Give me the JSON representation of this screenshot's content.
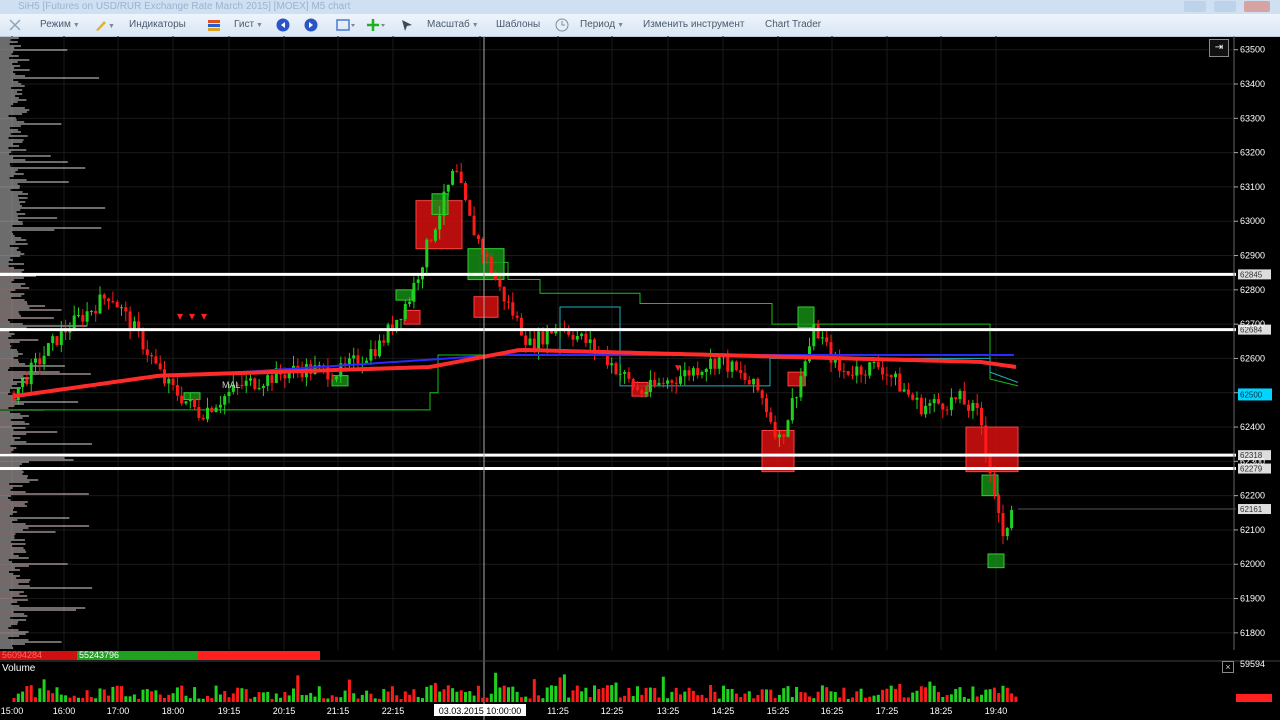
{
  "window": {
    "title": "SiH5 [Futures on USD/RUR Exchange Rate March 2015] [MOEX] M5 chart",
    "controls": [
      "minimize-icon",
      "maximize-icon",
      "close-icon"
    ]
  },
  "toolbar": {
    "items": [
      {
        "name": "mode-menu",
        "label": "Режим",
        "dropdown": true
      },
      {
        "name": "indicators-menu",
        "label": "Индикаторы",
        "dropdown": false
      },
      {
        "name": "hist-menu",
        "label": "Гист",
        "dropdown": true
      },
      {
        "name": "scale-menu",
        "label": "Масштаб",
        "dropdown": true
      },
      {
        "name": "templates-menu",
        "label": "Шаблоны",
        "dropdown": false
      },
      {
        "name": "period-menu",
        "label": "Период",
        "dropdown": true
      },
      {
        "name": "change-instrument-menu",
        "label": "Изменить инструмент",
        "dropdown": false
      },
      {
        "name": "chart-trader-menu",
        "label": "Chart Trader",
        "dropdown": false
      }
    ]
  },
  "chart_data": {
    "type": "candlestick",
    "instrument": "SiH5",
    "timeframe": "M5",
    "x_ticks": [
      "15:00",
      "16:00",
      "17:00",
      "18:00",
      "19:15",
      "20:15",
      "21:15",
      "22:15",
      "03.03.2015 10:00:00",
      "11:25",
      "12:25",
      "13:25",
      "14:25",
      "15:25",
      "16:25",
      "17:25",
      "18:25",
      "19:40"
    ],
    "crosshair_time": "03.03.2015 10:00:00",
    "y_ticks": [
      63500,
      63400,
      63300,
      63200,
      63100,
      63000,
      62900,
      62800,
      62700,
      62600,
      62500,
      62400,
      62300,
      62200,
      62100,
      62000,
      61900,
      61800
    ],
    "ylim": [
      61750,
      63540
    ],
    "levels": [
      62845,
      62684,
      62318,
      62279
    ],
    "level_labels": [
      "62845",
      "62684",
      "62318",
      "62279"
    ],
    "last_price_label": "62161",
    "current_price_label": "62500",
    "moving_average_label": "MAL",
    "volume": {
      "label": "Volume",
      "max_label": "59594"
    },
    "delta_bar": {
      "sell_label": "56094284",
      "buy_label": "55243796",
      "split": 0.24,
      "green_len": 0.38
    }
  },
  "colors": {
    "up": "#1fd11f",
    "down": "#ff1a1a",
    "ma_red": "#ff2a2a",
    "ma_blue": "#2a2aff",
    "level": "#ffffff",
    "grid": "#1a1a1a",
    "axis_text": "#ffffff",
    "price_tag": "#00d4ff"
  },
  "icons": {
    "jump": "jump-to-end-icon",
    "close": "close-subwindow-icon"
  }
}
